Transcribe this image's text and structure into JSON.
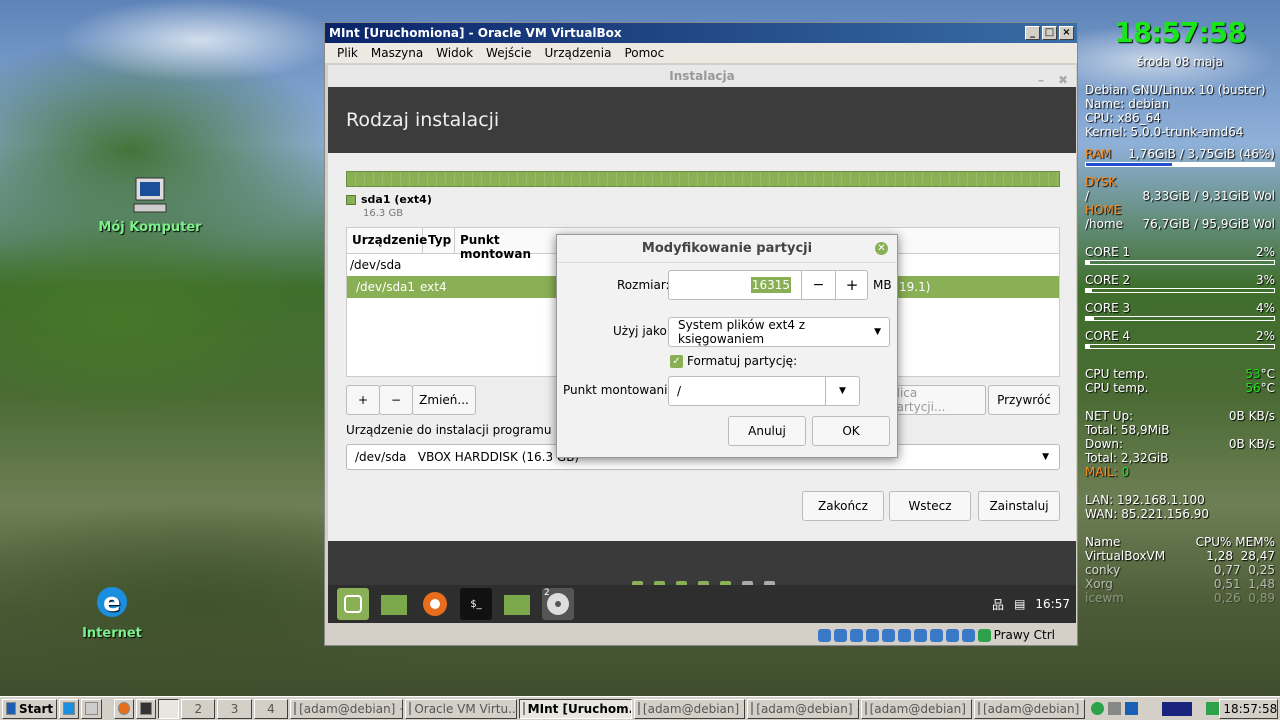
{
  "desktop": {
    "icons": [
      {
        "label": "Mój Komputer"
      },
      {
        "label": "Internet"
      }
    ]
  },
  "vm_window": {
    "title": "MInt [Uruchomiona] - Oracle VM VirtualBox",
    "menu": [
      "Plik",
      "Maszyna",
      "Widok",
      "Wejście",
      "Urządzenia",
      "Pomoc"
    ],
    "status_text": "Prawy Ctrl"
  },
  "installer": {
    "window_title": "Instalacja",
    "heading": "Rodzaj instalacji",
    "partition_legend": {
      "name": "sda1 (ext4)",
      "size": "16.3 GB"
    },
    "columns": [
      "Urządzenie",
      "Typ",
      "Punkt montowan"
    ],
    "rows": [
      {
        "device": "/dev/sda",
        "type": ""
      },
      {
        "device": "/dev/sda1",
        "type": "ext4",
        "extra": "19.1)"
      }
    ],
    "buttons": {
      "add": "+",
      "remove": "−",
      "change": "Zmień...",
      "new_table": "blica partycji...",
      "revert": "Przywróć"
    },
    "bootloader_label": "Urządzenie do instalacji programu rozru",
    "bootloader_value": "/dev/sda   VBOX HARDDISK (16.3 GB)",
    "nav": {
      "quit": "Zakończ",
      "back": "Wstecz",
      "install": "Zainstaluj"
    },
    "guest_time": "16:57",
    "workspace_num": "2"
  },
  "dialog": {
    "title": "Modyfikowanie partycji",
    "size_label": "Rozmiar:",
    "size_value": "16315",
    "size_unit": "MB",
    "minus": "−",
    "plus": "+",
    "use_as_label": "Użyj jako:",
    "use_as_value": "System plików ext4 z księgowaniem",
    "format_label": "Formatuj partycję:",
    "format_checked": true,
    "mount_label": "Punkt montowania:",
    "mount_value": "/",
    "cancel": "Anuluj",
    "ok": "OK"
  },
  "conky": {
    "time": "18:57:58",
    "date": "środa 08 maja",
    "sys": [
      "Debian GNU/Linux 10 (buster)",
      "Name: debian",
      "CPU: x86_64",
      "Kernel: 5.0.0-trunk-amd64"
    ],
    "ram_label": "RAM",
    "ram_value": "1,76GiB / 3,75GiB (46%)",
    "ram_fraction": 0.46,
    "disk_label": "DYSK",
    "disk_path": "/",
    "disk_value": "8,33GiB / 9,31GiB",
    "disk_suffix": "Wol",
    "home_label": "HOME",
    "home_path": "/home",
    "home_value": "76,7GiB / 95,9GiB",
    "home_suffix": "Wol",
    "cores": [
      {
        "name": "CORE 1",
        "val": "2%"
      },
      {
        "name": "CORE 2",
        "val": "3%"
      },
      {
        "name": "CORE 3",
        "val": "4%"
      },
      {
        "name": "CORE 4",
        "val": "2%"
      }
    ],
    "cpu_temp_label": "CPU temp.",
    "cpu_temp1": "53",
    "cpu_temp2": "56",
    "temp_unit": "°C",
    "net_up": "NET Up:",
    "net_up_val": "0B  KB/s",
    "total1": "Total: 58,9MiB",
    "down": "Down:",
    "down_val": "0B  KB/s",
    "total2": "Total: 2,32GiB",
    "mail_label": "MAIL:",
    "mail_val": "0",
    "lan": "LAN: 192.168.1.100",
    "wan": "WAN: 85.221.156.90",
    "proc_header": [
      "Name",
      "CPU%",
      "MEM%"
    ],
    "procs": [
      {
        "n": "VirtualBoxVM",
        "c": "1,28",
        "m": "28,47"
      },
      {
        "n": "conky",
        "c": "0,77",
        "m": "0,25"
      },
      {
        "n": "Xorg",
        "c": "0,51",
        "m": "1,48"
      },
      {
        "n": "icewm",
        "c": "0,26",
        "m": "0,89"
      }
    ]
  },
  "taskbar": {
    "start": "Start",
    "workspaces": [
      "2",
      "3",
      "4"
    ],
    "items": [
      "[adam@debian] ~",
      "Oracle VM Virtu...",
      "MInt [Uruchom...",
      "[adam@debian] ~",
      "[adam@debian] ~",
      "[adam@debian] ~",
      "[adam@debian] ~"
    ],
    "clock": "18:57:58"
  }
}
